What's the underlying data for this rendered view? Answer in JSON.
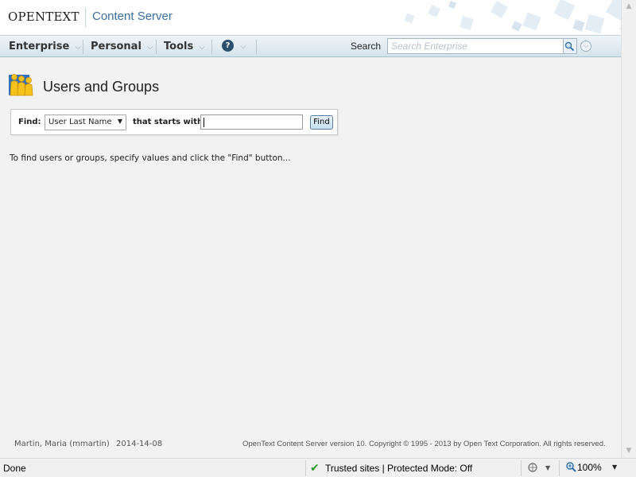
{
  "header": {
    "logo_text": "OPENTEXT",
    "product_name": "Content Server"
  },
  "nav": {
    "items": [
      {
        "label": "Enterprise"
      },
      {
        "label": "Personal"
      },
      {
        "label": "Tools"
      }
    ],
    "search_label": "Search",
    "search_placeholder": "Search Enterprise"
  },
  "page": {
    "title": "Users and Groups",
    "find_label": "Find:",
    "find_field_selected": "User Last Name",
    "starts_with_label": "that starts with",
    "find_value": "",
    "find_button": "Find",
    "instruction": "To find users or groups, specify values and click the \"Find\" button..."
  },
  "footer": {
    "user": "Martin, Maria (mmartin)",
    "date": "2014-14-08",
    "copyright": "OpenText Content Server version 10. Copyright © 1995 - 2013 by Open Text Corporation. All rights reserved."
  },
  "statusbar": {
    "status": "Done",
    "zone": "Trusted sites | Protected Mode: Off",
    "zoom": "100%"
  },
  "colors": {
    "brand_blue": "#3a6fa0",
    "nav_gradient_top": "#eef4f8",
    "nav_gradient_bottom": "#d5e3ec",
    "trusted_check": "#2e9b2e"
  }
}
